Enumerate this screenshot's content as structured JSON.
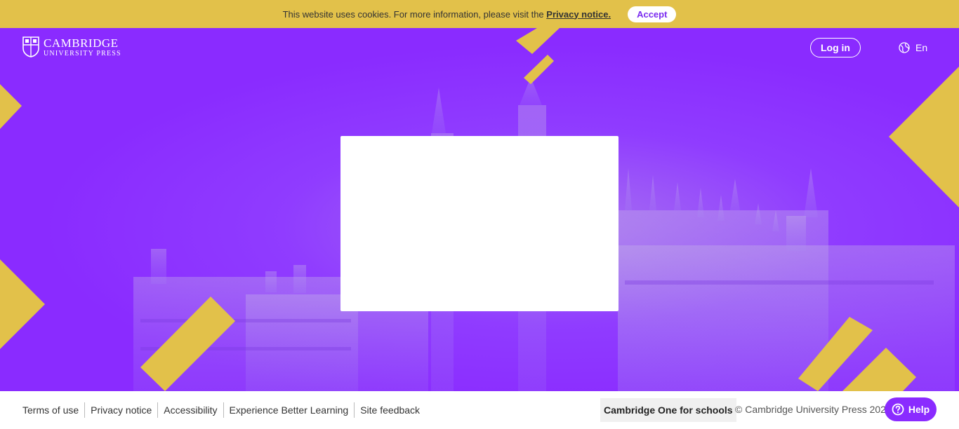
{
  "cookie": {
    "text": "This website uses cookies. For more information, please visit the",
    "link": "Privacy notice.",
    "accept": "Accept"
  },
  "header": {
    "logo_main": "CAMBRIDGE",
    "logo_sub": "UNIVERSITY PRESS",
    "login": "Log in",
    "language": "En"
  },
  "footer": {
    "links": [
      "Terms of use",
      "Privacy notice",
      "Accessibility",
      "Experience Better Learning",
      "Site feedback"
    ],
    "schools": "Cambridge One for schools",
    "copyright": "© Cambridge University Press 2022",
    "help": "Help"
  },
  "colors": {
    "brand_purple": "#8a2bff",
    "accent_yellow": "#e2c14a"
  }
}
